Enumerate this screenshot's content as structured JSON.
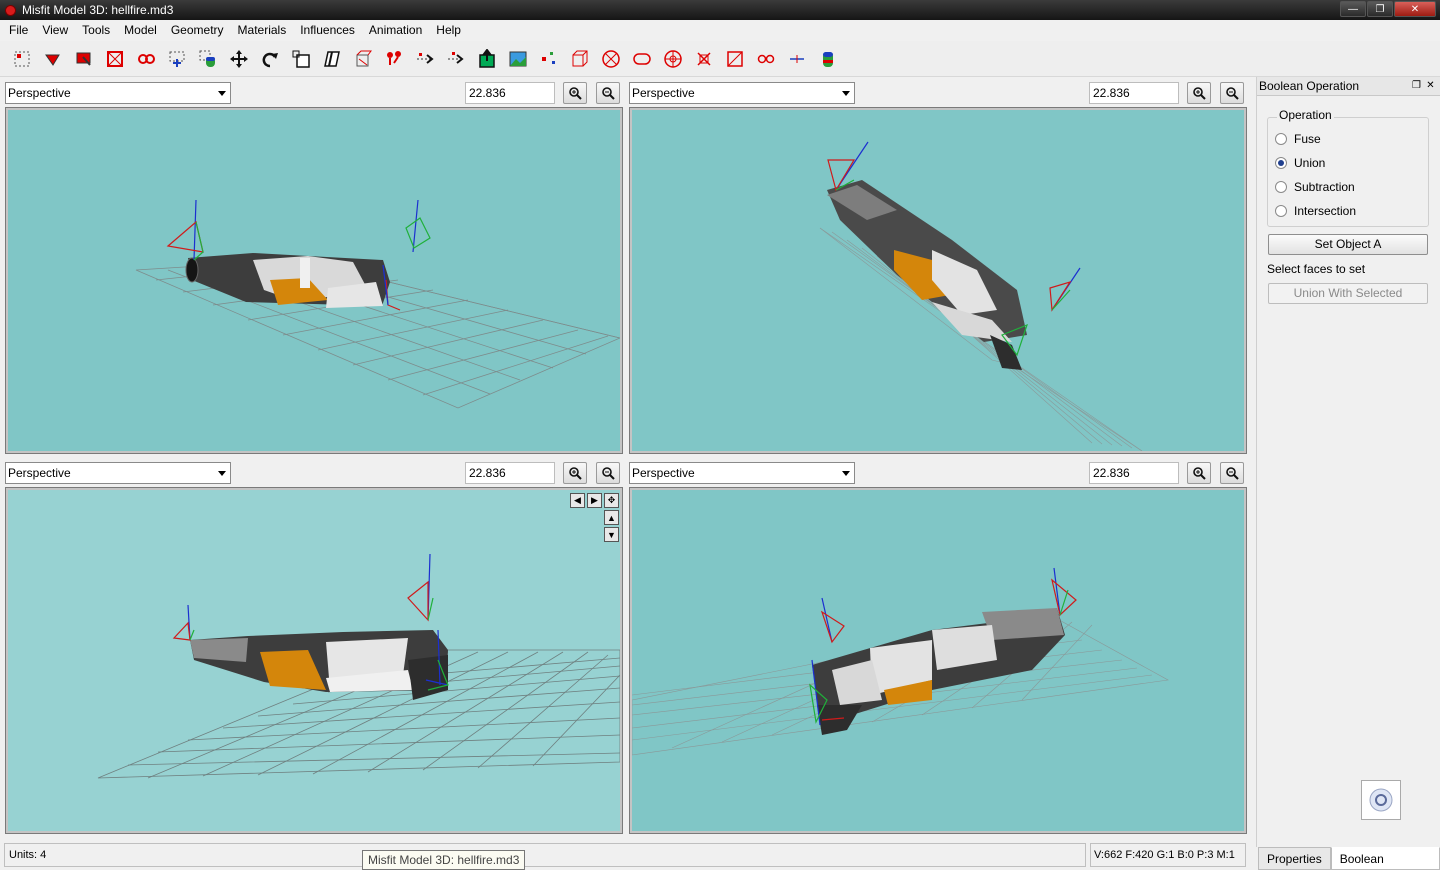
{
  "window": {
    "title": "Misfit Model 3D: hellfire.md3"
  },
  "menu": [
    "File",
    "View",
    "Tools",
    "Model",
    "Geometry",
    "Materials",
    "Influences",
    "Animation",
    "Help"
  ],
  "toolbar": {
    "tools": [
      "select-vertices-icon",
      "select-faces-icon",
      "select-connected-icon",
      "select-groups-icon",
      "select-bone-joints-icon",
      "select-points-icon",
      "select-projections-icon",
      "move-icon",
      "rotate-icon",
      "scale-icon",
      "shear-icon",
      "extrude-icon",
      "attach-vertices-icon",
      "create-vertex-icon",
      "create-point-icon",
      "create-bone-joint-icon",
      "background-icon",
      "create-projection-icon",
      "create-cube-icon",
      "create-ellipsoid-icon",
      "create-cylinder-icon",
      "create-torus-icon",
      "create-polygon-icon",
      "create-rectangle-icon",
      "drag-vertex-icon",
      "bezier-icon",
      "cylinder-shape-icon"
    ]
  },
  "viewports": [
    {
      "projection": "Perspective",
      "zoom": "22.836"
    },
    {
      "projection": "Perspective",
      "zoom": "22.836"
    },
    {
      "projection": "Perspective",
      "zoom": "22.836"
    },
    {
      "projection": "Perspective",
      "zoom": "22.836"
    }
  ],
  "boolean_panel": {
    "title": "Boolean Operation",
    "group_label": "Operation",
    "options": [
      "Fuse",
      "Union",
      "Subtraction",
      "Intersection"
    ],
    "selected": "Union",
    "set_object_label": "Set Object A",
    "hint": "Select faces to set",
    "apply_label": "Union With Selected"
  },
  "status": {
    "units": "Units: 4",
    "stats": "V:662 F:420 G:1 B:0 P:3 M:1",
    "tooltip": "Misfit Model 3D: hellfire.md3"
  },
  "dock_tabs": [
    "Properties",
    "Boolean Operation"
  ],
  "colors": {
    "viewport_bg": "#80c6c6",
    "active_viewport_bg": "#97d2d2",
    "title_bar": "#151515"
  }
}
